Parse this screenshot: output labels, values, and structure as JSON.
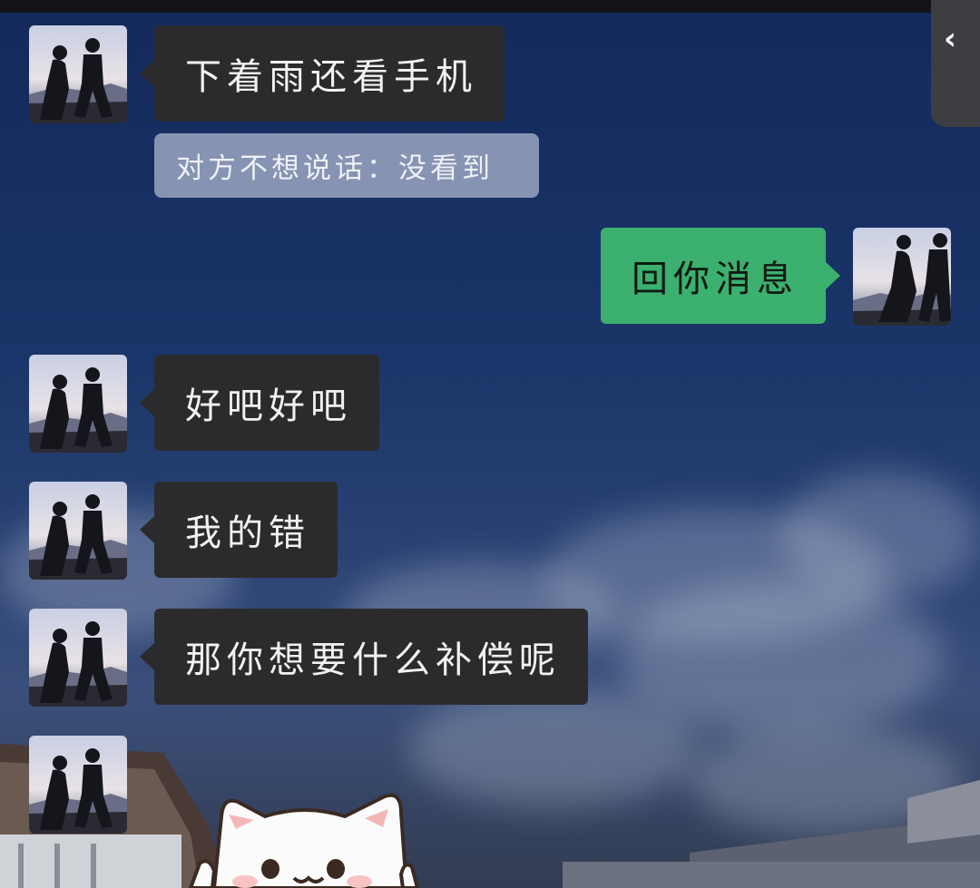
{
  "colors": {
    "incoming_bubble": "#2b2b2d",
    "outgoing_bubble": "#3cb06e",
    "system_notice": "#8793b2",
    "back_tab": "#3d3e42"
  },
  "back_button": {
    "icon": "chevron-left-icon",
    "glyph": "‹"
  },
  "messages": [
    {
      "side": "incoming",
      "text": "下着雨还看手机"
    },
    {
      "side": "system",
      "text": "对方不想说话：没看到"
    },
    {
      "side": "outgoing",
      "text": "回你消息"
    },
    {
      "side": "incoming",
      "text": "好吧好吧"
    },
    {
      "side": "incoming",
      "text": "我的错"
    },
    {
      "side": "incoming",
      "text": "那你想要什么补偿呢"
    },
    {
      "side": "incoming",
      "type": "sticker",
      "sticker": "white-cat-sticker"
    }
  ]
}
